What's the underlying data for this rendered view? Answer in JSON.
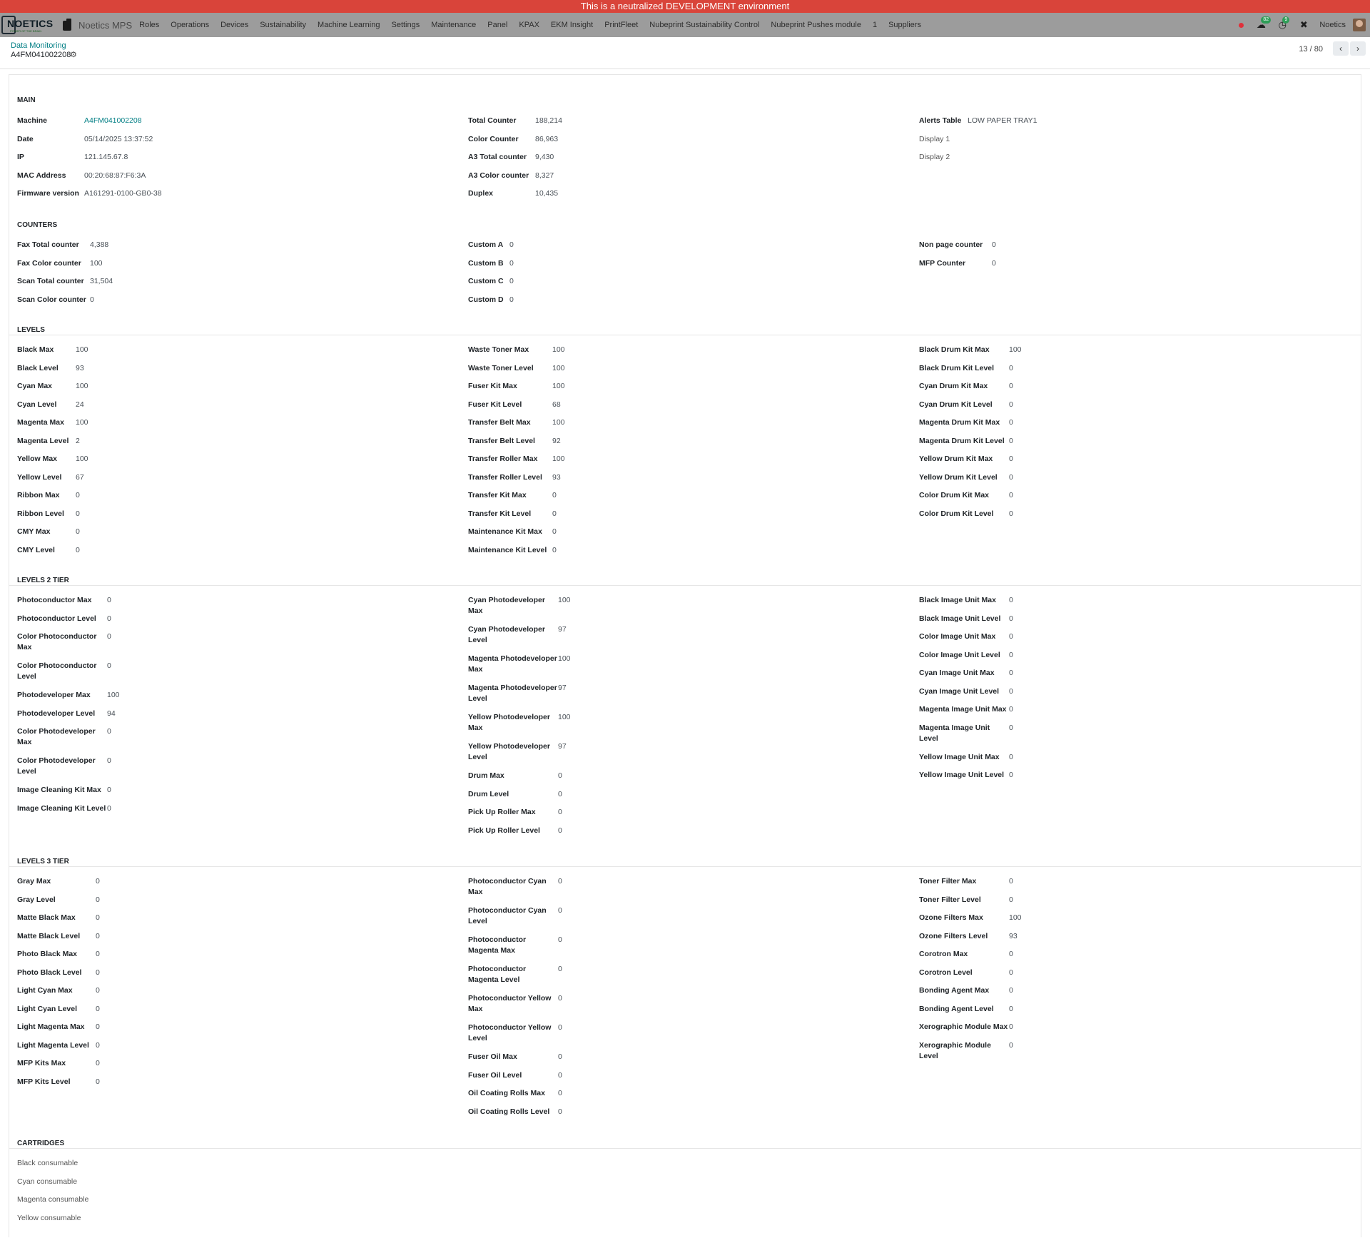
{
  "banner": "This is a neutralized DEVELOPMENT environment",
  "nav": {
    "logo_text": "NOETICS",
    "logo_sub": "POWER OF THE BRAIN",
    "app_name": "Noetics MPS",
    "menu": [
      "Roles",
      "Operations",
      "Devices",
      "Sustainability",
      "Machine Learning",
      "Settings",
      "Maintenance",
      "Panel",
      "KPAX",
      "EKM Insight",
      "PrintFleet",
      "Nubeprint Sustainability Control",
      "Nubeprint Pushes module",
      "1",
      "Suppliers"
    ],
    "messages_count": "82",
    "activities_count": "9",
    "company": "Noetics"
  },
  "breadcrumb": {
    "parent": "Data Monitoring",
    "title": "A4FM041002208"
  },
  "pager": {
    "value": "13 / 80"
  },
  "sections": {
    "main": {
      "title": "MAIN",
      "col1": [
        {
          "label": "Machine",
          "value": "A4FM041002208"
        },
        {
          "label": "Date",
          "value": "05/14/2025 13:37:52"
        },
        {
          "label": "IP",
          "value": "121.145.67.8"
        },
        {
          "label": "MAC Address",
          "value": "00:20:68:87:F6:3A"
        },
        {
          "label": "Firmware version",
          "value": "A161291-0100-GB0-38"
        }
      ],
      "col2": [
        {
          "label": "Total Counter",
          "value": "188,214"
        },
        {
          "label": "Color Counter",
          "value": "86,963"
        },
        {
          "label": "A3 Total counter",
          "value": "9,430"
        },
        {
          "label": "A3 Color counter",
          "value": "8,327"
        },
        {
          "label": "Duplex",
          "value": "10,435"
        }
      ],
      "col3": [
        {
          "label": "Alerts Table",
          "value": "LOW PAPER TRAY1"
        },
        {
          "label": "Display 1",
          "value": ""
        },
        {
          "label": "Display 2",
          "value": ""
        }
      ]
    },
    "counters": {
      "title": "COUNTERS",
      "col1": [
        {
          "label": "Fax Total counter",
          "value": "4,388"
        },
        {
          "label": "Fax Color counter",
          "value": "100"
        },
        {
          "label": "Scan Total counter",
          "value": "31,504"
        },
        {
          "label": "Scan Color counter",
          "value": "0"
        }
      ],
      "col2": [
        {
          "label": "Custom A",
          "value": "0"
        },
        {
          "label": "Custom B",
          "value": "0"
        },
        {
          "label": "Custom C",
          "value": "0"
        },
        {
          "label": "Custom D",
          "value": "0"
        }
      ],
      "col3": [
        {
          "label": "Non page counter",
          "value": "0"
        },
        {
          "label": "MFP Counter",
          "value": "0"
        }
      ]
    },
    "levels": {
      "title": "LEVELS",
      "col1": [
        {
          "label": "Black Max",
          "value": "100"
        },
        {
          "label": "Black Level",
          "value": "93"
        },
        {
          "label": "Cyan Max",
          "value": "100"
        },
        {
          "label": "Cyan Level",
          "value": "24"
        },
        {
          "label": "Magenta Max",
          "value": "100"
        },
        {
          "label": "Magenta Level",
          "value": "2"
        },
        {
          "label": "Yellow Max",
          "value": "100"
        },
        {
          "label": "Yellow Level",
          "value": "67"
        },
        {
          "label": "Ribbon Max",
          "value": "0"
        },
        {
          "label": "Ribbon Level",
          "value": "0"
        },
        {
          "label": "CMY Max",
          "value": "0"
        },
        {
          "label": "CMY Level",
          "value": "0"
        }
      ],
      "col2": [
        {
          "label": "Waste Toner Max",
          "value": "100"
        },
        {
          "label": "Waste Toner Level",
          "value": "100"
        },
        {
          "label": "Fuser Kit Max",
          "value": "100"
        },
        {
          "label": "Fuser Kit Level",
          "value": "68"
        },
        {
          "label": "Transfer Belt Max",
          "value": "100"
        },
        {
          "label": "Transfer Belt Level",
          "value": "92"
        },
        {
          "label": "Transfer Roller Max",
          "value": "100"
        },
        {
          "label": "Transfer Roller Level",
          "value": "93"
        },
        {
          "label": "Transfer Kit Max",
          "value": "0"
        },
        {
          "label": "Transfer Kit Level",
          "value": "0"
        },
        {
          "label": "Maintenance Kit Max",
          "value": "0"
        },
        {
          "label": "Maintenance Kit Level",
          "value": "0"
        }
      ],
      "col3": [
        {
          "label": "Black Drum Kit Max",
          "value": "100"
        },
        {
          "label": "Black Drum Kit Level",
          "value": "0"
        },
        {
          "label": "Cyan Drum Kit Max",
          "value": "0"
        },
        {
          "label": "Cyan Drum Kit Level",
          "value": "0"
        },
        {
          "label": "Magenta Drum Kit Max",
          "value": "0"
        },
        {
          "label": "Magenta Drum Kit Level",
          "value": "0"
        },
        {
          "label": "Yellow Drum Kit Max",
          "value": "0"
        },
        {
          "label": "Yellow Drum Kit Level",
          "value": "0"
        },
        {
          "label": "Color Drum Kit Max",
          "value": "0"
        },
        {
          "label": "Color Drum Kit Level",
          "value": "0"
        }
      ]
    },
    "levels2": {
      "title": "LEVELS 2 TIER",
      "col1": [
        {
          "label": "Photoconductor Max",
          "value": "0"
        },
        {
          "label": "Photoconductor Level",
          "value": "0"
        },
        {
          "label": "Color Photoconductor Max",
          "value": "0"
        },
        {
          "label": "Color Photoconductor Level",
          "value": "0"
        },
        {
          "label": "Photodeveloper Max",
          "value": "100"
        },
        {
          "label": "Photodeveloper Level",
          "value": "94"
        },
        {
          "label": "Color Photodeveloper Max",
          "value": "0"
        },
        {
          "label": "Color Photodeveloper Level",
          "value": "0"
        },
        {
          "label": "Image Cleaning Kit Max",
          "value": "0"
        },
        {
          "label": "Image Cleaning Kit Level",
          "value": "0"
        }
      ],
      "col2": [
        {
          "label": "Cyan Photodeveloper Max",
          "value": "100"
        },
        {
          "label": "Cyan Photodeveloper Level",
          "value": "97"
        },
        {
          "label": "Magenta Photodeveloper Max",
          "value": "100"
        },
        {
          "label": "Magenta Photodeveloper Level",
          "value": "97"
        },
        {
          "label": "Yellow Photodeveloper Max",
          "value": "100"
        },
        {
          "label": "Yellow Photodeveloper Level",
          "value": "97"
        },
        {
          "label": "Drum Max",
          "value": "0"
        },
        {
          "label": "Drum Level",
          "value": "0"
        },
        {
          "label": "Pick Up Roller Max",
          "value": "0"
        },
        {
          "label": "Pick Up Roller Level",
          "value": "0"
        }
      ],
      "col3": [
        {
          "label": "Black Image Unit Max",
          "value": "0"
        },
        {
          "label": "Black Image Unit Level",
          "value": "0"
        },
        {
          "label": "Color Image Unit Max",
          "value": "0"
        },
        {
          "label": "Color Image Unit Level",
          "value": "0"
        },
        {
          "label": "Cyan Image Unit Max",
          "value": "0"
        },
        {
          "label": "Cyan Image Unit Level",
          "value": "0"
        },
        {
          "label": "Magenta Image Unit Max",
          "value": "0"
        },
        {
          "label": "Magenta Image Unit Level",
          "value": "0"
        },
        {
          "label": "Yellow Image Unit Max",
          "value": "0"
        },
        {
          "label": "Yellow Image Unit Level",
          "value": "0"
        }
      ]
    },
    "levels3": {
      "title": "LEVELS 3 TIER",
      "col1": [
        {
          "label": "Gray Max",
          "value": "0"
        },
        {
          "label": "Gray Level",
          "value": "0"
        },
        {
          "label": "Matte Black Max",
          "value": "0"
        },
        {
          "label": "Matte Black Level",
          "value": "0"
        },
        {
          "label": "Photo Black Max",
          "value": "0"
        },
        {
          "label": "Photo Black Level",
          "value": "0"
        },
        {
          "label": "Light Cyan Max",
          "value": "0"
        },
        {
          "label": "Light Cyan Level",
          "value": "0"
        },
        {
          "label": "Light Magenta Max",
          "value": "0"
        },
        {
          "label": "Light Magenta Level",
          "value": "0"
        },
        {
          "label": "MFP Kits Max",
          "value": "0"
        },
        {
          "label": "MFP Kits Level",
          "value": "0"
        }
      ],
      "col2": [
        {
          "label": "Photoconductor Cyan Max",
          "value": "0"
        },
        {
          "label": "Photoconductor Cyan Level",
          "value": "0"
        },
        {
          "label": "Photoconductor Magenta Max",
          "value": "0"
        },
        {
          "label": "Photoconductor Magenta Level",
          "value": "0"
        },
        {
          "label": "Photoconductor Yellow Max",
          "value": "0"
        },
        {
          "label": "Photoconductor Yellow Level",
          "value": "0"
        },
        {
          "label": "Fuser Oil Max",
          "value": "0"
        },
        {
          "label": "Fuser Oil Level",
          "value": "0"
        },
        {
          "label": "Oil Coating Rolls Max",
          "value": "0"
        },
        {
          "label": "Oil Coating Rolls Level",
          "value": "0"
        }
      ],
      "col3": [
        {
          "label": "Toner Filter Max",
          "value": "0"
        },
        {
          "label": "Toner Filter Level",
          "value": "0"
        },
        {
          "label": "Ozone Filters Max",
          "value": "100"
        },
        {
          "label": "Ozone Filters Level",
          "value": "93"
        },
        {
          "label": "Corotron Max",
          "value": "0"
        },
        {
          "label": "Corotron Level",
          "value": "0"
        },
        {
          "label": "Bonding Agent Max",
          "value": "0"
        },
        {
          "label": "Bonding Agent Level",
          "value": "0"
        },
        {
          "label": "Xerographic Module Max",
          "value": "0"
        },
        {
          "label": "Xerographic Module Level",
          "value": "0"
        }
      ]
    },
    "cartridges": {
      "title": "CARTRIDGES",
      "items": [
        "Black consumable",
        "Cyan consumable",
        "Magenta consumable",
        "Yellow consumable"
      ]
    }
  },
  "colors": {
    "banner": "#d9443a",
    "navbar": "#9c9c9c",
    "link": "#017e84",
    "badge": "#2e9d57"
  }
}
